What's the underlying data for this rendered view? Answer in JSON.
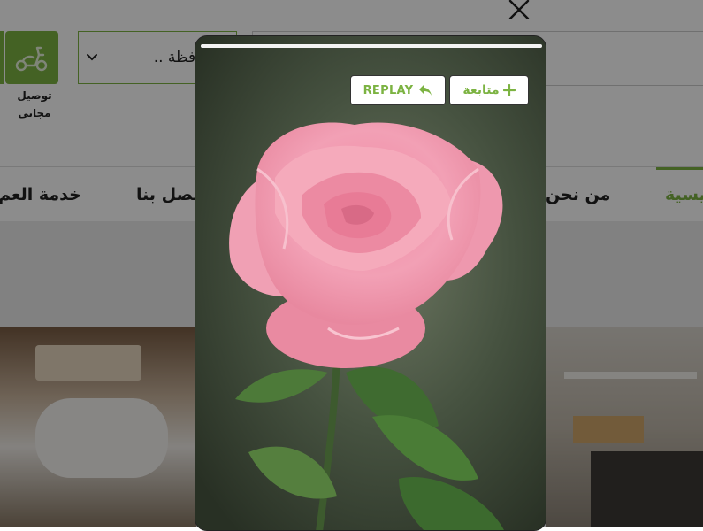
{
  "header": {
    "delivery": {
      "label": "توصيل مجاني",
      "line1": "توصيل",
      "line2": "مجاني"
    },
    "governorate_select": {
      "value": "المحافظة .."
    }
  },
  "nav": {
    "items": [
      {
        "label": "الرئيسية",
        "visible_text": "يسية",
        "active": true
      },
      {
        "label": "من نحن",
        "visible_text": "من نحن"
      },
      {
        "label": "اتصل بنا",
        "visible_text": "تصل بنا"
      },
      {
        "label": "خدمة العملاء",
        "visible_text": "خدمة العم"
      }
    ]
  },
  "story": {
    "progress": 1.0,
    "follow_label": "متابعة",
    "replay_label": "REPLAY"
  },
  "colors": {
    "accent": "#7cb342",
    "overlay": "rgba(0,0,0,0.45)"
  },
  "icons": [
    "close-icon",
    "scooter-icon",
    "chevron-down-icon",
    "plus-icon",
    "replay-arrow-icon"
  ]
}
